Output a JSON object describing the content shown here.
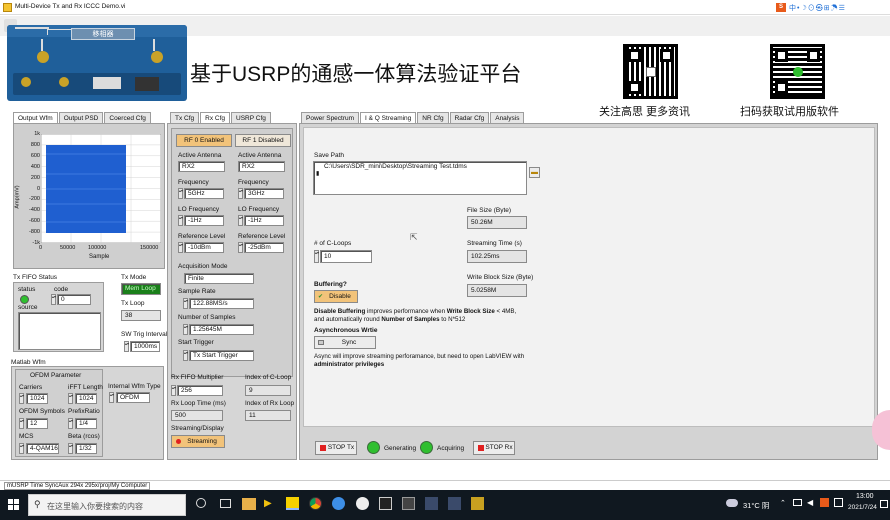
{
  "window": {
    "title": "Multi-Device Tx and Rx ICCC Demo.vi",
    "tray": [
      "中",
      "•",
      "☽",
      "⊙",
      "㉿",
      "⊞",
      "☂",
      "☰"
    ]
  },
  "banner": {
    "device_label": "移相器",
    "title": "基于USRP的通感一体算法验证平台",
    "qr1_caption": "关注高思 更多资讯",
    "qr2_caption": "扫码获取试用版软件"
  },
  "left": {
    "tabs": [
      "Output Wfm",
      "Output PSD",
      "Coerced Cfg"
    ],
    "chart": {
      "ylabel": "Amp(mV)",
      "xlabel": "Sample",
      "yticks": [
        "1k",
        "800",
        "600",
        "400",
        "200",
        "0",
        "-200",
        "-400",
        "-600",
        "-800",
        "-1k"
      ],
      "xticks": [
        "0",
        "50000",
        "100000",
        "150000"
      ]
    },
    "tx_fifo": {
      "title": "Tx FIFO Status",
      "status_label": "status",
      "code_label": "code",
      "code_value": "0",
      "source_label": "source"
    },
    "tx_mode": {
      "label": "Tx Mode",
      "value": "Mem Loop"
    },
    "tx_loop": {
      "label": "Tx Loop",
      "value": "38"
    },
    "sw_trig": {
      "label": "SW Trig Interval",
      "value": "1000ms"
    },
    "matlab": {
      "title": "Matlab Wfm",
      "ofdm_title": "OFDM Parameter",
      "carriers_label": "Carriers",
      "carriers": "1024",
      "ifft_label": "iFFT Length",
      "ifft": "1024",
      "internal_label": "Internal Wfm Type",
      "internal": "OFDM",
      "symbols_label": "OFDM Symbols",
      "symbols": "12",
      "prefix_label": "PrefixRatio",
      "prefix": "1/4",
      "mcs_label": "MCS",
      "mcs": "4-QAM16",
      "beta_label": "Beta (rcos)",
      "beta": "1/32"
    }
  },
  "mid": {
    "tabs": [
      "Tx Cfg",
      "Rx Cfg",
      "USRP Cfg"
    ],
    "rf0": {
      "button": "RF 0 Enabled",
      "antenna_label": "Active Antenna",
      "antenna": "RX2",
      "freq_label": "Frequency",
      "freq": "5GHz",
      "lo_label": "LO Frequency",
      "lo": "-1Hz",
      "ref_label": "Reference Level",
      "ref": "-10dBm"
    },
    "rf1": {
      "button": "RF 1 Disabled",
      "antenna_label": "Active Antenna",
      "antenna": "RX2",
      "freq_label": "Frequency",
      "freq": "3GHz",
      "lo_label": "LO Frequency",
      "lo": "-1Hz",
      "ref_label": "Reference Level",
      "ref": "-25dBm"
    },
    "acq_mode_label": "Acquisition Mode",
    "acq_mode": "Finite",
    "rate_label": "Sample Rate",
    "rate": "122.88MS/s",
    "samples_label": "Number of Samples",
    "samples": "1.25645M",
    "trigger_label": "Start Trigger",
    "trigger": "Tx Start Trigger",
    "fifo_mult_label": "Rx FIFO Multiplier",
    "fifo_mult": "256",
    "cloop_idx_label": "Index of C-Loop",
    "cloop_idx": "9",
    "rxloop_time_label": "Rx Loop Time (ms)",
    "rxloop_time": "500",
    "rxloop_idx_label": "Index of Rx Loop",
    "rxloop_idx": "11",
    "stream_label": "Streaming/Display",
    "stream_button": "Streaming"
  },
  "right": {
    "tabs": [
      "Power Spectrum",
      "I & Q Streaming",
      "NR Cfg",
      "Radar Cfg",
      "Analysis"
    ],
    "save_path_label": "Save Path",
    "save_path": "C:\\Users\\SDR_mini\\Desktop\\Streaming Test.tdms",
    "file_size_label": "File Size (Byte)",
    "file_size": "50.26M",
    "cloops_label": "# of C-Loops",
    "cloops": "10",
    "stream_time_label": "Streaming Time (s)",
    "stream_time": "102.25ms",
    "block_label": "Write Block Size (Byte)",
    "block": "5.0258M",
    "buffering_label": "Buffering?",
    "buffering_button": "Disable",
    "buf_text1a": "Disable Buffering",
    "buf_text1b": " improves performance when ",
    "buf_text1c": "Write Block Size",
    "buf_text1d": " < 4MB,",
    "buf_text2a": "and automatically round ",
    "buf_text2b": "Number of Samples",
    "buf_text2c": " to N*512",
    "async_label": "Asynchronous Wrtie",
    "sync_button": "Sync",
    "async_text1": "Async will improve streaming perforamance, but need to open LabVIEW with",
    "async_text2": "administrator privileges",
    "stop_tx": "STOP Tx",
    "generating": "Generating",
    "acquiring": "Acquiring",
    "stop_rx": "STOP Rx"
  },
  "status_bar": "mUSRP Time SyncAux 294x 295x/proj/My Computer",
  "taskbar": {
    "search_placeholder": "在这里输入你要搜索的内容",
    "weather": "31°C 阴",
    "time": "13:00",
    "date": "2021/7/24"
  },
  "colors": {
    "accent": "#0078d7",
    "signal": "#1f5fd0",
    "led_green": "#2fbf2f",
    "button_orange": "#f2c37a",
    "stop_red": "#e02020"
  }
}
